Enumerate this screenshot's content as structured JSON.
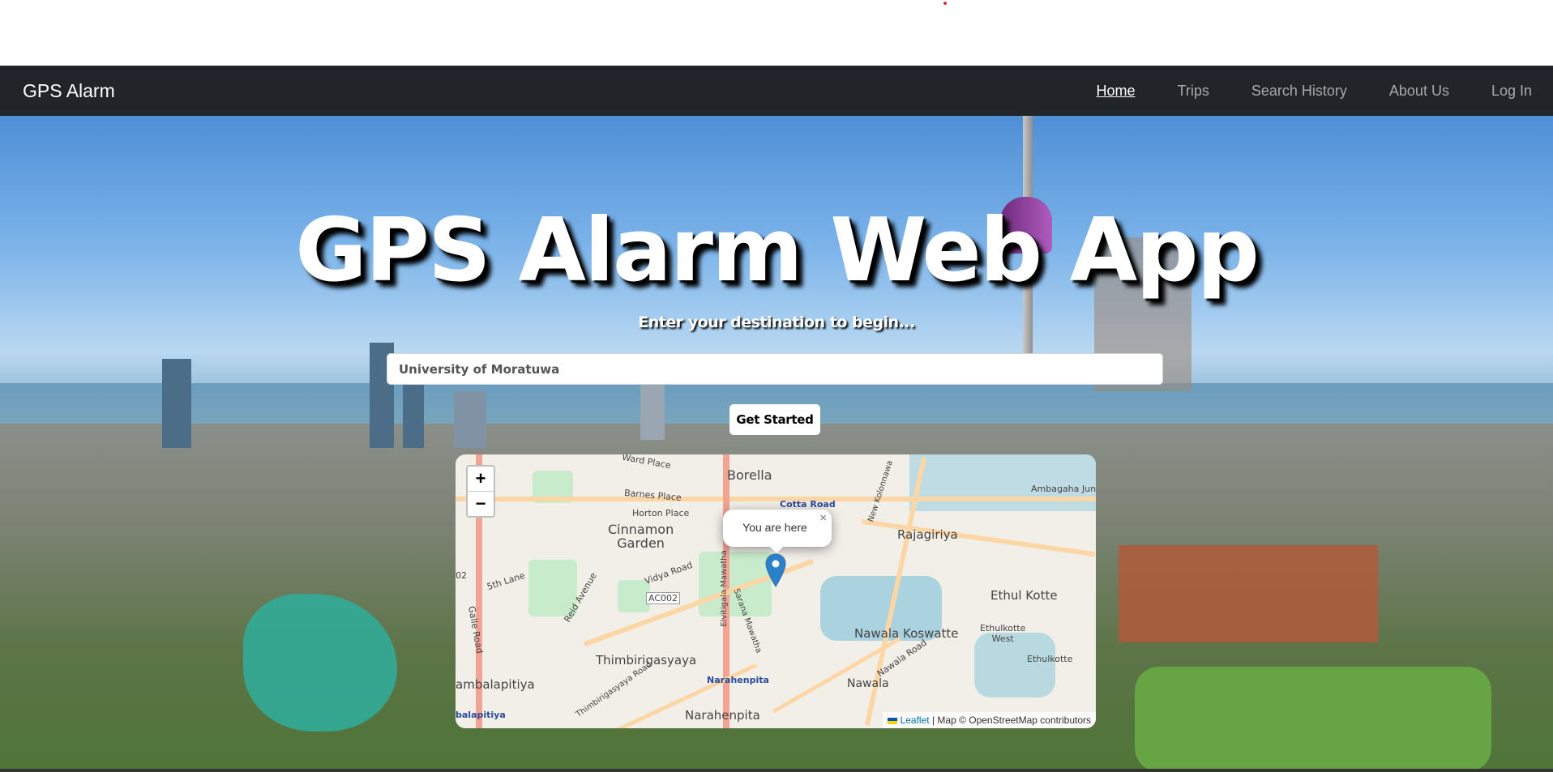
{
  "navbar": {
    "brand": "GPS Alarm",
    "links": [
      {
        "label": "Home",
        "active": true
      },
      {
        "label": "Trips"
      },
      {
        "label": "Search History"
      },
      {
        "label": "About Us"
      },
      {
        "label": "Log In"
      }
    ]
  },
  "hero": {
    "title": "GPS Alarm Web App",
    "subtitle": "Enter your destination to begin...",
    "destination_value": "University of Moratuwa",
    "button_label": "Get Started"
  },
  "map": {
    "zoom_in_label": "+",
    "zoom_out_label": "−",
    "popup_text": "You are here",
    "popup_close": "×",
    "marker_icon": "map-pin-icon",
    "attribution_leaflet": "Leaflet",
    "attribution_text": " | Map © OpenStreetMap contributors",
    "labels": {
      "borella": "Borella",
      "ward_place": "Ward Place",
      "barnes_place": "Barnes Place",
      "horton_place": "Horton Place",
      "cotta_road": "Cotta Road",
      "new_kolonnawa": "New Kolonnawa",
      "ambagaha": "Ambagaha Jun",
      "cinnamon_garden": "Cinnamon\nGarden",
      "rajagiriya": "Rajagiriya",
      "vidya_road": "Vidya Road",
      "ac002": "AC002",
      "fifth_lane": "5th Lane",
      "reid_avenue": "Reid Avenue",
      "galle_road": "Galle Road",
      "elvitigala": "Elvitigala Mawatha",
      "sarana": "Sarana Mawatha",
      "thimbirigasyaya": "Thimbirigasyaya",
      "ethul_kotte": "Ethul Kotte",
      "nawala_koswatte": "Nawala Koswatte",
      "ethulkotte_west": "Ethulkotte\nWest",
      "ethulkotte": "Ethulkotte",
      "nawala_road": "Nawala Road",
      "nawala": "Nawala",
      "narahenpita_blue": "Narahenpita",
      "narahenpita": "Narahenpita",
      "bambalapitiya": "ambalapitiya",
      "bambalapitiya_blue": "balapitiya",
      "thimbirigasyaya_road": "Thimbirigasyaya Road",
      "code_02": "02"
    }
  },
  "colors": {
    "navbar_bg": "#212529",
    "map_popup_bg": "#ffffff",
    "marker": "#2a81cb"
  }
}
